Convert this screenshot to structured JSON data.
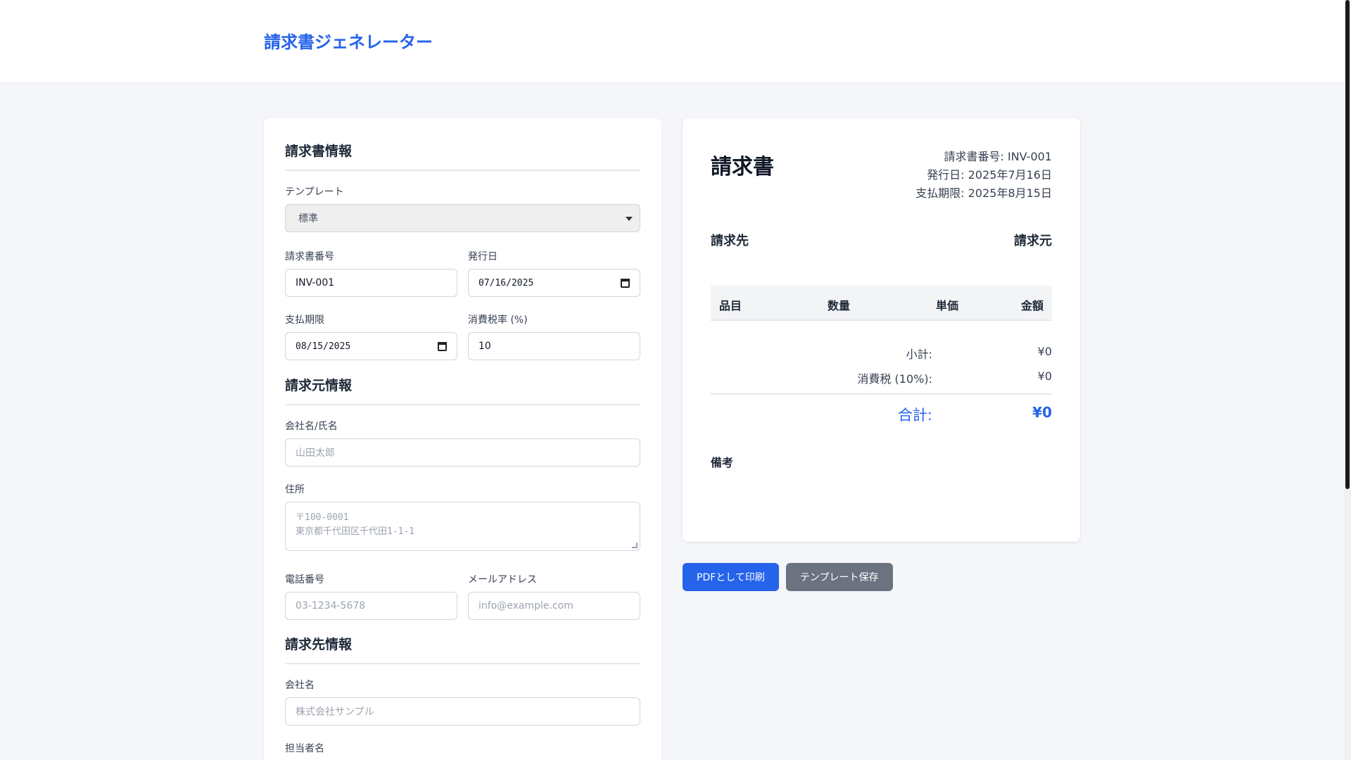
{
  "app": {
    "title": "請求書ジェネレーター"
  },
  "colors": {
    "accent": "#2563eb",
    "secondary_button": "#6b7280"
  },
  "form": {
    "invoice_section": {
      "title": "請求書情報",
      "template_label": "テンプレート",
      "template_value": "標準",
      "number_label": "請求書番号",
      "number_value": "INV-001",
      "issue_date_label": "発行日",
      "issue_date_value": "07/16/2025",
      "due_date_label": "支払期限",
      "due_date_value": "08/15/2025",
      "tax_rate_label": "消費税率 (%)",
      "tax_rate_value": "10"
    },
    "sender_section": {
      "title": "請求元情報",
      "name_label": "会社名/氏名",
      "name_placeholder": "山田太郎",
      "address_label": "住所",
      "address_placeholder_line1": "〒100-0001",
      "address_placeholder_line2": "東京都千代田区千代田1-1-1",
      "phone_label": "電話番号",
      "phone_placeholder": "03-1234-5678",
      "email_label": "メールアドレス",
      "email_placeholder": "info@example.com"
    },
    "client_section": {
      "title": "請求先情報",
      "company_label": "会社名",
      "company_placeholder": "株式会社サンプル",
      "contact_label": "担当者名"
    }
  },
  "preview": {
    "title": "請求書",
    "meta": {
      "number": "請求書番号: INV-001",
      "issue_date": "発行日: 2025年7月16日",
      "due_date": "支払期限: 2025年8月15日"
    },
    "bill_to": "請求先",
    "bill_from": "請求元",
    "table_headers": [
      "品目",
      "数量",
      "単価",
      "金額"
    ],
    "subtotal_label": "小計:",
    "subtotal_value": "¥0",
    "tax_label": "消費税 (10%):",
    "tax_value": "¥0",
    "total_label": "合計:",
    "total_value": "¥0",
    "notes_label": "備考"
  },
  "actions": {
    "print_label": "PDFとして印刷",
    "save_template_label": "テンプレート保存"
  }
}
